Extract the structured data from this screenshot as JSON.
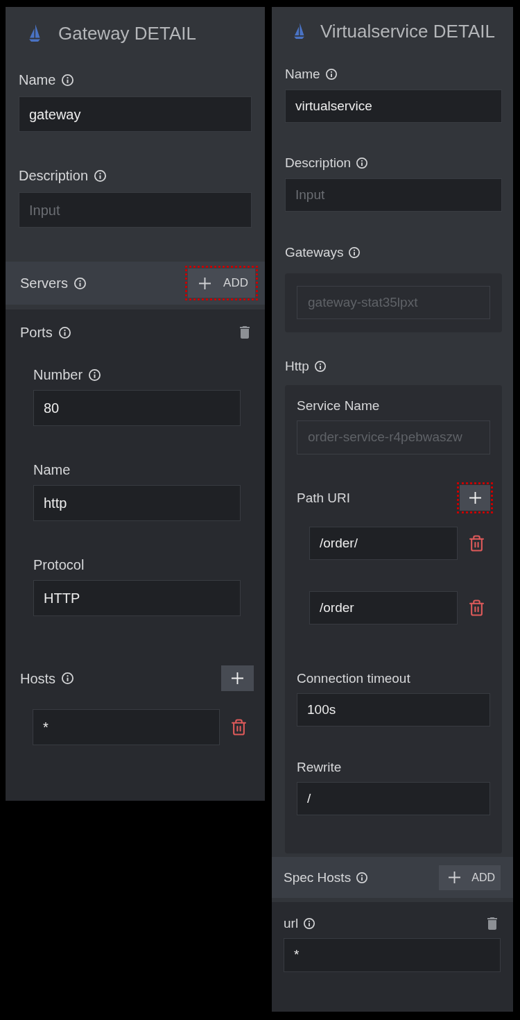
{
  "gateway": {
    "title": "Gateway DETAIL",
    "fields": [
      {
        "label": "Name",
        "info": true,
        "value": "gateway"
      },
      {
        "label": "Description",
        "info": true,
        "placeholder": "Input"
      }
    ],
    "servers": {
      "label": "Servers",
      "info": true,
      "add_button": {
        "label": "ADD",
        "highlighted": true
      },
      "ports": {
        "label": "Ports",
        "info": true,
        "fields": [
          {
            "label": "Number",
            "info": true,
            "value": "80"
          },
          {
            "label": "Name",
            "info": false,
            "value": "http"
          },
          {
            "label": "Protocol",
            "info": false,
            "value": "HTTP"
          }
        ]
      },
      "hosts": {
        "label": "Hosts",
        "info": true,
        "add_button": {
          "highlighted": false
        },
        "items": [
          {
            "value": "*"
          }
        ]
      }
    }
  },
  "virtualservice": {
    "title": "Virtualservice DETAIL",
    "fields": [
      {
        "label": "Name",
        "info": true,
        "value": "virtualservice"
      },
      {
        "label": "Description",
        "info": true,
        "placeholder": "Input"
      }
    ],
    "gateways": {
      "label": "Gateways",
      "info": true,
      "items": [
        {
          "value": "gateway-stat35lpxt",
          "disabled": true
        }
      ]
    },
    "http": {
      "label": "Http",
      "info": true,
      "service_name": {
        "label": "Service Name",
        "info": false,
        "value": "order-service-r4pebwaszw",
        "disabled": true
      },
      "path_uri": {
        "label": "Path URI",
        "info": false,
        "add_button": {
          "highlighted": true
        },
        "items": [
          {
            "value": "/order/"
          },
          {
            "value": "/order"
          }
        ]
      },
      "fields": [
        {
          "label": "Connection timeout",
          "info": false,
          "value": "100s"
        },
        {
          "label": "Rewrite",
          "info": false,
          "value": "/"
        }
      ]
    },
    "spec_hosts": {
      "label": "Spec Hosts",
      "info": true,
      "add_button": {
        "label": "ADD",
        "highlighted": false
      },
      "items": [
        {
          "label": "url",
          "info": true,
          "value": "*"
        }
      ]
    }
  }
}
